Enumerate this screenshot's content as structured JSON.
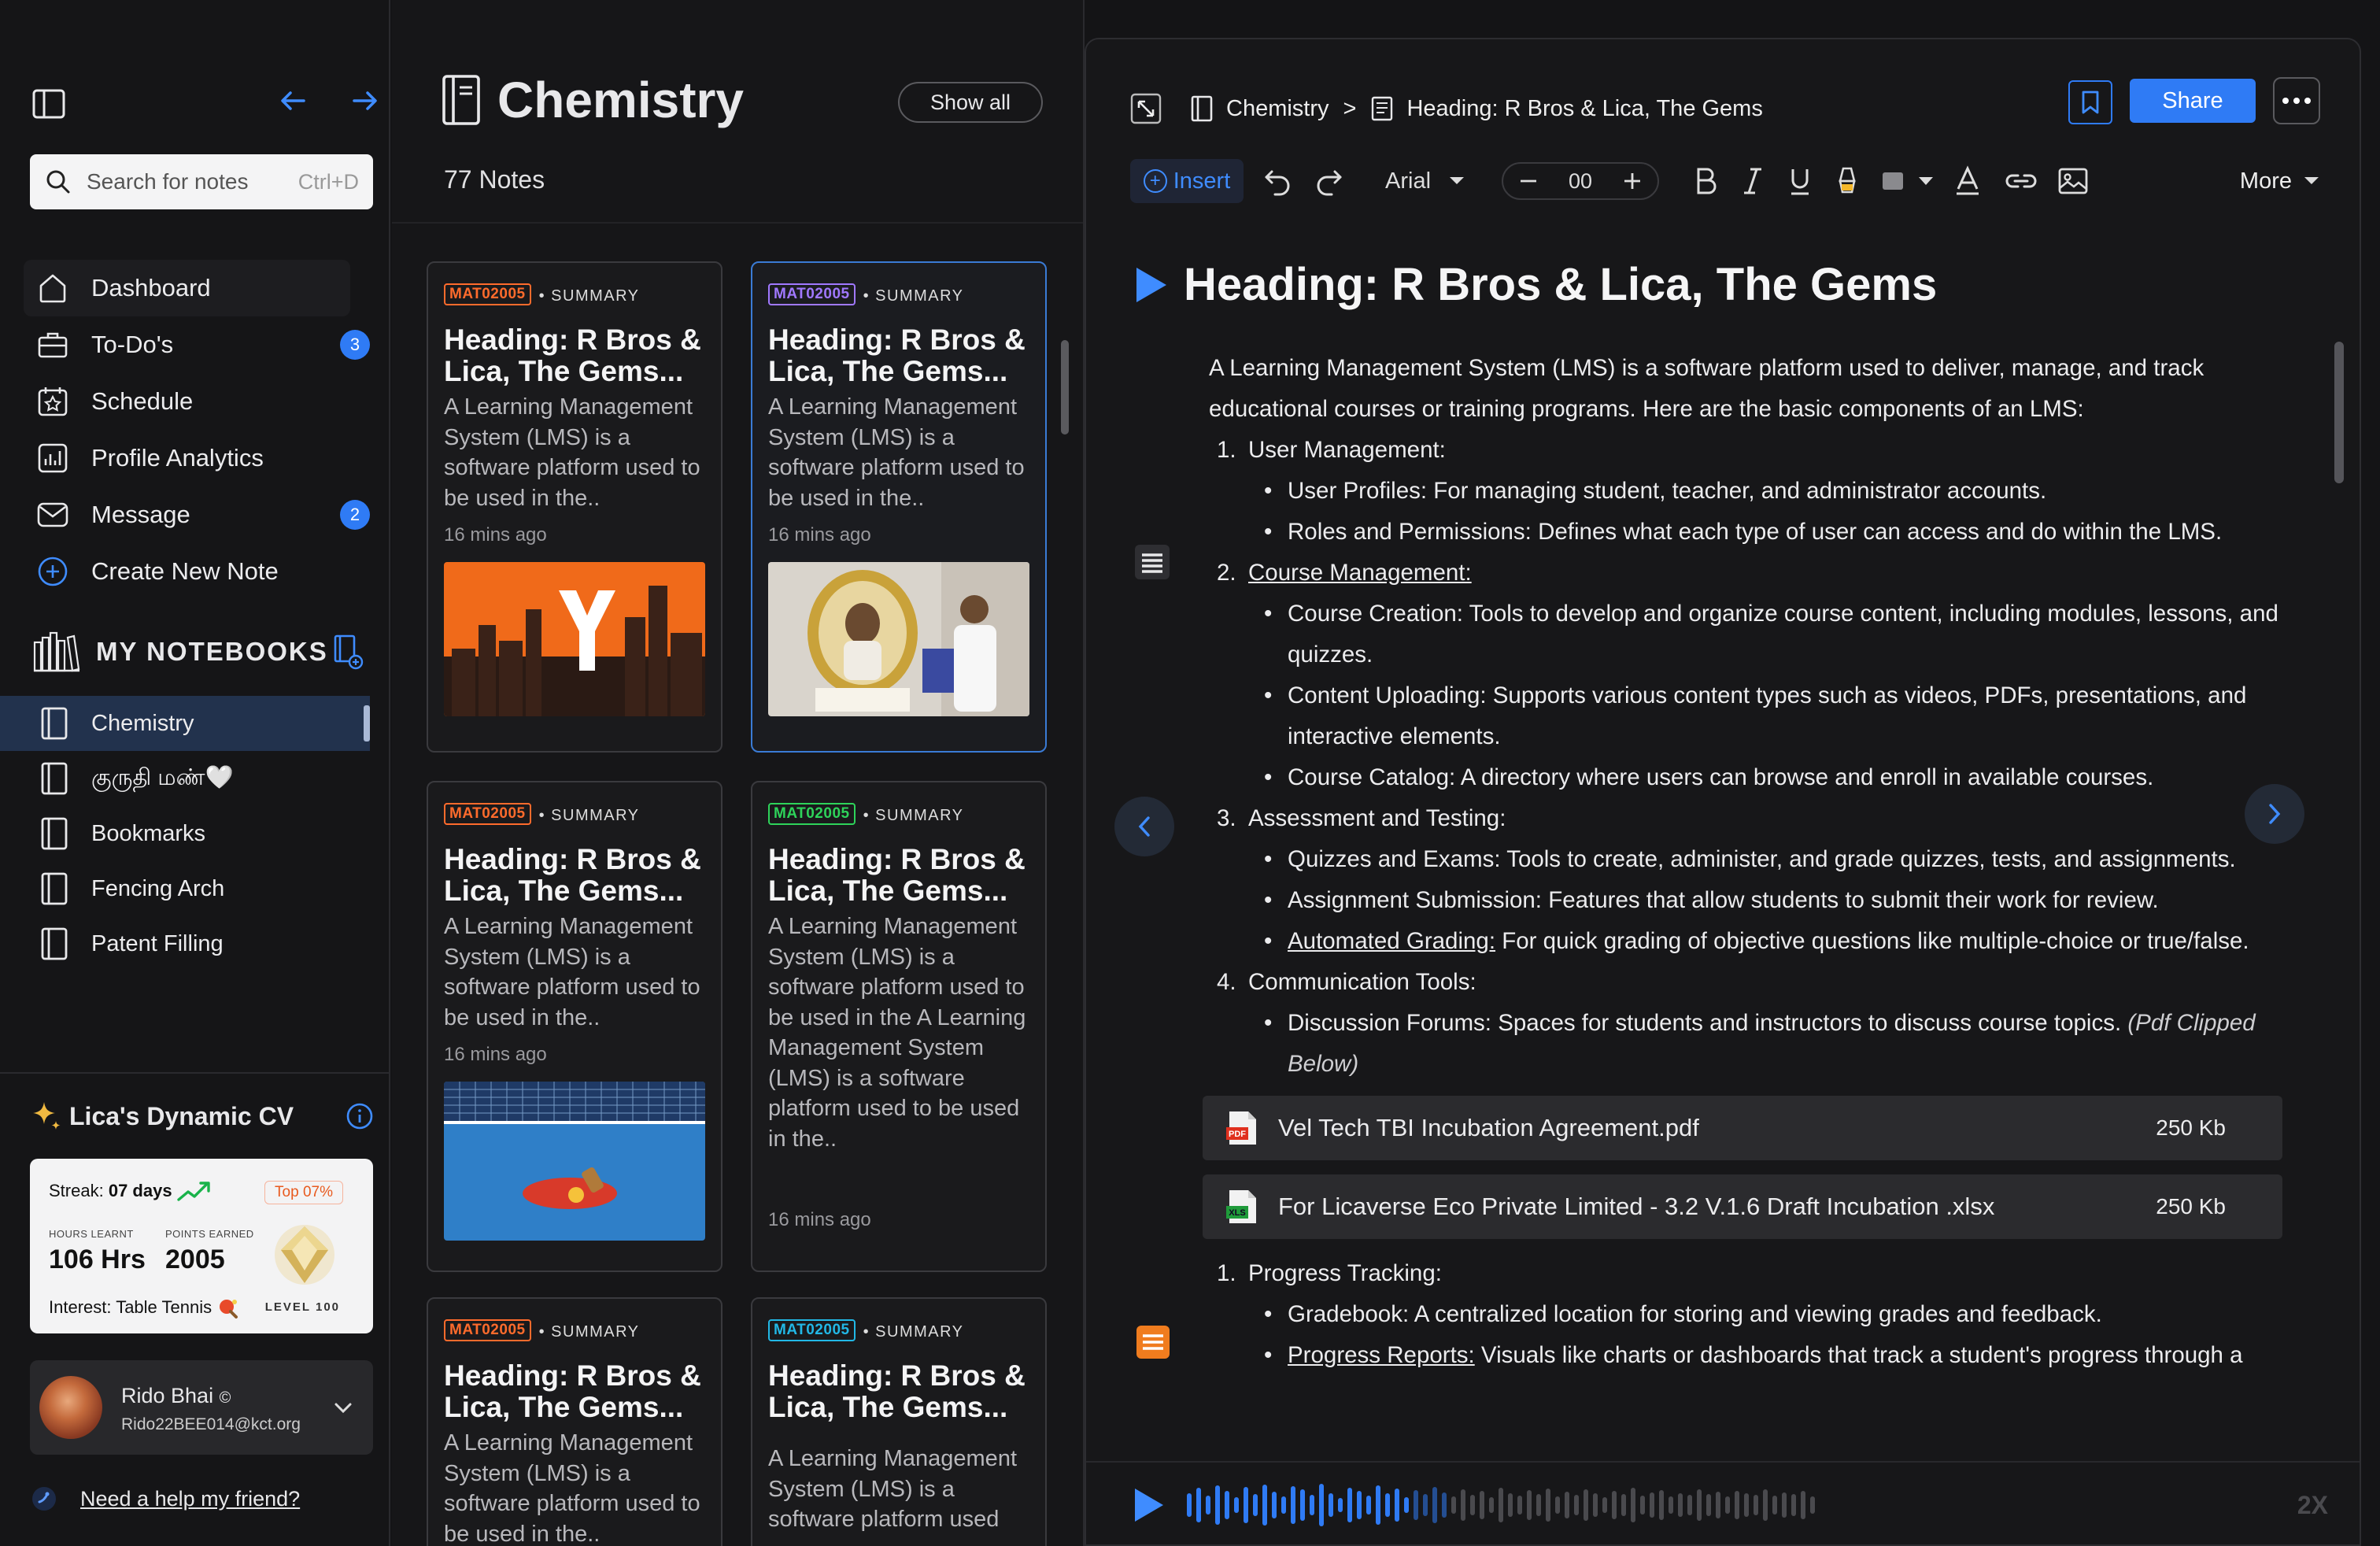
{
  "sidebar": {
    "search": {
      "placeholder": "Search for notes",
      "shortcut": "Ctrl+D"
    },
    "menu": [
      {
        "label": "Dashboard"
      },
      {
        "label": "To-Do's",
        "badge": "3"
      },
      {
        "label": "Schedule"
      },
      {
        "label": "Profile Analytics"
      },
      {
        "label": "Message",
        "badge": "2"
      },
      {
        "label": "Create New Note"
      }
    ],
    "notebooks_heading": "MY NOTEBOOKS",
    "notebooks": [
      {
        "label": "Chemistry"
      },
      {
        "label": "குருதி மண்🤍"
      },
      {
        "label": "Bookmarks"
      },
      {
        "label": "Fencing Arch"
      },
      {
        "label": "Patent Filling"
      }
    ],
    "cv": {
      "title": "Lica's Dynamic CV",
      "streak_label": "Streak:",
      "streak_value": "07 days",
      "top": "Top 07%",
      "hours_label": "HOURS LEARNT",
      "hours_value": "106 Hrs",
      "points_label": "POINTS EARNED",
      "points_value": "2005",
      "interest": "Interest: Table Tennis",
      "level": "LEVEL 100"
    },
    "user": {
      "name": "Rido Bhai",
      "email": "Rido22BEE014@kct.org"
    },
    "help": "Need a help my friend?"
  },
  "notes": {
    "title": "Chemistry",
    "show_all": "Show all",
    "count": "77 Notes",
    "cards": [
      {
        "tag": "MAT02005",
        "tag_color": "orange",
        "type": "SUMMARY",
        "title": "Heading: R Bros & Lica, The Gems...",
        "body": "A Learning Management System (LMS) is a software platform used to be used in the..",
        "time": "16 mins ago",
        "image": "yc-city"
      },
      {
        "tag": "MAT02005",
        "tag_color": "purple",
        "type": "SUMMARY",
        "title": "Heading: R Bros & Lica, The Gems...",
        "body": "A Learning Management System (LMS) is a software platform used to be used in the..",
        "time": "16 mins ago",
        "image": "award-photo"
      },
      {
        "tag": "MAT02005",
        "tag_color": "orange",
        "type": "SUMMARY",
        "title": "Heading: R Bros & Lica, The Gems...",
        "body": "A Learning Management System (LMS) is a software platform used to be used in the..",
        "time": "16 mins ago",
        "image": "table-tennis"
      },
      {
        "tag": "MAT02005",
        "tag_color": "green",
        "type": "SUMMARY",
        "title": "Heading: R Bros & Lica, The Gems...",
        "body": "A Learning Management System (LMS) is a software platform used to be used in the A Learning Management System (LMS) is a software platform used to be used in the..",
        "time": "16 mins ago"
      },
      {
        "tag": "MAT02005",
        "tag_color": "orange",
        "type": "SUMMARY",
        "title": "Heading: R Bros & Lica, The Gems...",
        "body": "A Learning Management System (LMS) is a software platform used to be used in the.."
      },
      {
        "tag": "MAT02005",
        "tag_color": "cyan",
        "type": "SUMMARY",
        "title": "Heading: R Bros & Lica, The Gems...",
        "body": "A Learning Management System (LMS) is a software platform used"
      }
    ]
  },
  "editor": {
    "breadcrumb": {
      "notebook": "Chemistry",
      "sep": ">",
      "note": "Heading: R Bros & Lica, The Gems"
    },
    "share": "Share",
    "toolbar": {
      "insert": "Insert",
      "font": "Arial",
      "size": "00",
      "more": "More"
    },
    "title": "Heading: R Bros & Lica, The Gems",
    "intro": "A Learning Management System (LMS) is a software platform used to deliver, manage, and track educational courses or training programs. Here are the basic components of an LMS:",
    "s1": {
      "n": "1.",
      "t": "User Management:",
      "a": "User Profiles: For managing student, teacher, and administrator accounts.",
      "b": "Roles and Permissions: Defines what each type of user can access and do within the LMS."
    },
    "s2": {
      "n": "2.",
      "t": "Course Management:",
      "a": "Course Creation: Tools to develop and organize course content, including modules, lessons, and quizzes.",
      "b": "Content Uploading: Supports various content types such as videos, PDFs, presentations, and interactive elements.",
      "c": "Course Catalog: A directory where users can browse and enroll in available courses."
    },
    "s3": {
      "n": "3.",
      "t": "Assessment and Testing:",
      "a": "Quizzes and Exams: Tools to create, administer, and grade quizzes, tests, and assignments.",
      "b": "Assignment Submission: Features that allow students to submit their work for review.",
      "c_link": "Automated Grading:",
      "c": " For quick grading of objective questions like multiple-choice or true/false."
    },
    "s4": {
      "n": "4.",
      "t": "Communication Tools:",
      "a": "Discussion Forums: Spaces for students and instructors to discuss course topics. ",
      "a_note": "(Pdf Clipped Below)"
    },
    "files": [
      {
        "name": "Vel Tech TBI Incubation Agreement.pdf",
        "size": "250 Kb",
        "kind": "PDF"
      },
      {
        "name": "For Licaverse Eco Private Limited - 3.2 V.1.6 Draft Incubation .xlsx",
        "size": "250 Kb",
        "kind": "XLS"
      }
    ],
    "s5": {
      "n": "1.",
      "t": "Progress Tracking:",
      "a": "Gradebook: A centralized location for storing and viewing grades and feedback.",
      "b_link": "Progress Reports:",
      "b": " Visuals like charts or dashboards that track a student's progress through a"
    },
    "audio": {
      "speed": "2X"
    },
    "colors": {
      "accent": "#2f7bf5",
      "waveform_played": "#2f7bf5",
      "waveform_rest": "#4a4a4e"
    }
  }
}
